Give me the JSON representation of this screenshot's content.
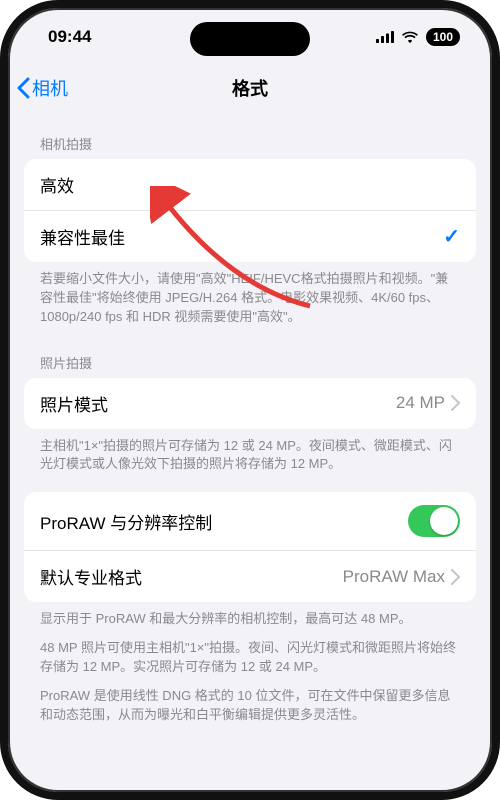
{
  "status": {
    "time": "09:44",
    "battery_text": "100"
  },
  "nav": {
    "back_label": "相机",
    "title": "格式"
  },
  "section_capture": {
    "header": "相机拍摄",
    "option_high_efficiency": "高效",
    "option_most_compatible": "兼容性最佳",
    "footer": "若要缩小文件大小，请使用\"高效\"HEIF/HEVC格式拍摄照片和视频。\"兼容性最佳\"将始终使用 JPEG/H.264 格式。电影效果视频、4K/60 fps、1080p/240 fps 和 HDR 视频需要使用\"高效\"。"
  },
  "section_photo": {
    "header": "照片拍摄",
    "row_photo_mode_label": "照片模式",
    "row_photo_mode_value": "24 MP",
    "footer": "主相机\"1×\"拍摄的照片可存储为 12 或 24 MP。夜间模式、微距模式、闪光灯模式或人像光效下拍摄的照片将存储为 12 MP。"
  },
  "section_proraw": {
    "row_proraw_control_label": "ProRAW 与分辨率控制",
    "row_default_format_label": "默认专业格式",
    "row_default_format_value": "ProRAW Max",
    "footer1": "显示用于 ProRAW 和最大分辨率的相机控制，最高可达 48 MP。",
    "footer2": "48 MP 照片可使用主相机\"1×\"拍摄。夜间、闪光灯模式和微距照片将始终存储为 12 MP。实况照片可存储为 12 或 24 MP。",
    "footer3": "ProRAW 是使用线性 DNG 格式的 10 位文件，可在文件中保留更多信息和动态范围，从而为曝光和白平衡编辑提供更多灵活性。"
  }
}
